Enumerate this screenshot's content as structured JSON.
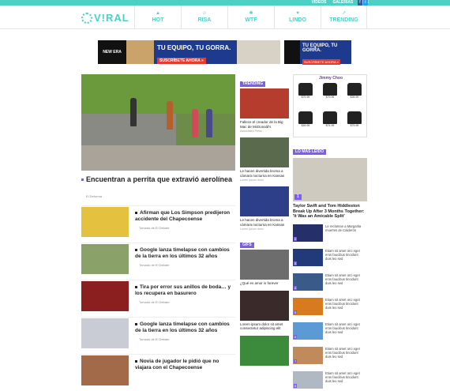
{
  "topbar": {
    "links": [
      "VIDEOS",
      "GALERIAS",
      "GIFS"
    ],
    "social": [
      "f",
      "t"
    ]
  },
  "header": {
    "logo": "V!RAL",
    "nav": [
      {
        "label": "HOT",
        "icon": "flame-icon"
      },
      {
        "label": "RISA",
        "icon": "smile-icon"
      },
      {
        "label": "WTF",
        "icon": "wtf-icon"
      },
      {
        "label": "LINDO",
        "icon": "heart-icon"
      },
      {
        "label": "TRENDING",
        "icon": "trend-icon"
      }
    ]
  },
  "ads": {
    "banner_brand": "NEW ERA",
    "banner_headline": "TU EQUIPO, TU GORRA.",
    "banner_cta": "SUSCRÍBETE AHORA »",
    "side_headline": "TU EQUIPO, TU GORRA.",
    "side_cta": "SUSCRÍBETE AHORA »"
  },
  "hero": {
    "title": "Encuentran a perrita que extravió aerolínea",
    "meta": "El Deforma"
  },
  "list": [
    {
      "title": "Afirman que Los Simpson predijeron accidente del Chapecoense",
      "meta": "Tomado de El Debate",
      "color": "#e5c140"
    },
    {
      "title": "Google lanza timelapse con cambios de la tierra en los últimos 32 años",
      "meta": "Tomado de El Debate",
      "color": "#8aa16a"
    },
    {
      "title": "Tira por error sus anillos de boda… y los recupera en basurero",
      "meta": "Tomado de El Debate",
      "color": "#8b1e1e"
    },
    {
      "title": "Google lanza timelapse con cambios de la tierra en los últimos 32 años",
      "meta": "Tomado de El Debate",
      "color": "#c9ccd4"
    },
    {
      "title": "Novia de jugador le pidió que no viajara con el Chapecoense",
      "meta": "",
      "color": "#a36a4a"
    }
  ],
  "trending": {
    "label": "TRENDING",
    "cards": [
      {
        "title": "Fallece el creador de la Big Mac de McDonald's",
        "meta": "Associated Press",
        "color": "#b53d2d"
      },
      {
        "title": "Le hacen divertida broma a cámara nocturna en Kansas",
        "meta": "Lorem ipsum dolor",
        "color": "#5a6a4c"
      },
      {
        "title": "Le hacen divertida broma a cámara nocturna en Kansas",
        "meta": "Lorem ipsum dolor",
        "color": "#2e3f8a"
      }
    ]
  },
  "gifs": {
    "label": "GIFS",
    "cards": [
      {
        "title": "¿Qué es amor is forever",
        "meta": "",
        "color": "#6d6d6d"
      },
      {
        "title": "Lorem ipsum dolor sit amet consectetur adipiscing elit",
        "meta": "",
        "color": "#3a2a2a"
      },
      {
        "title": "",
        "meta": "",
        "color": "#3c8a3c"
      }
    ]
  },
  "sidebar": {
    "ad_title": "Jimmy Choo",
    "prices": [
      "$79.99",
      "$79.99",
      "$39.99",
      "$49.99",
      "$74.99",
      "$79.99"
    ],
    "mostread_label": "LO MÁS LEÍDO",
    "feature_number": "1",
    "feature_title": "Taylor Swift and Tom Hiddleston Break Up After 3 Months Together: 'It Was an Amicable Split'",
    "items": [
      {
        "n": "2",
        "text": "Le reclaman a Margarita muertes de Calderón",
        "color": "#25306a"
      },
      {
        "n": "3",
        "text": "Etiam sit amet orci eget eros faucibus tincidunt duis leo sed",
        "color": "#233a7a"
      },
      {
        "n": "4",
        "text": "Etiam sit amet orci eget eros faucibus tincidunt duis leo sed",
        "color": "#3a5a8a"
      },
      {
        "n": "5",
        "text": "Etiam sit amet orci eget eros faucibus tincidunt duis leo sed",
        "color": "#d87a1e"
      },
      {
        "n": "6",
        "text": "Etiam sit amet orci eget eros faucibus tincidunt duis leo sed",
        "color": "#5b9ad5"
      },
      {
        "n": "7",
        "text": "Etiam sit amet orci eget eros faucibus tincidunt duis leo sed",
        "color": "#c08a5a"
      },
      {
        "n": "8",
        "text": "Etiam sit amet orci eget eros faucibus tincidunt duis leo sed",
        "color": "#b0b8c4"
      }
    ]
  }
}
